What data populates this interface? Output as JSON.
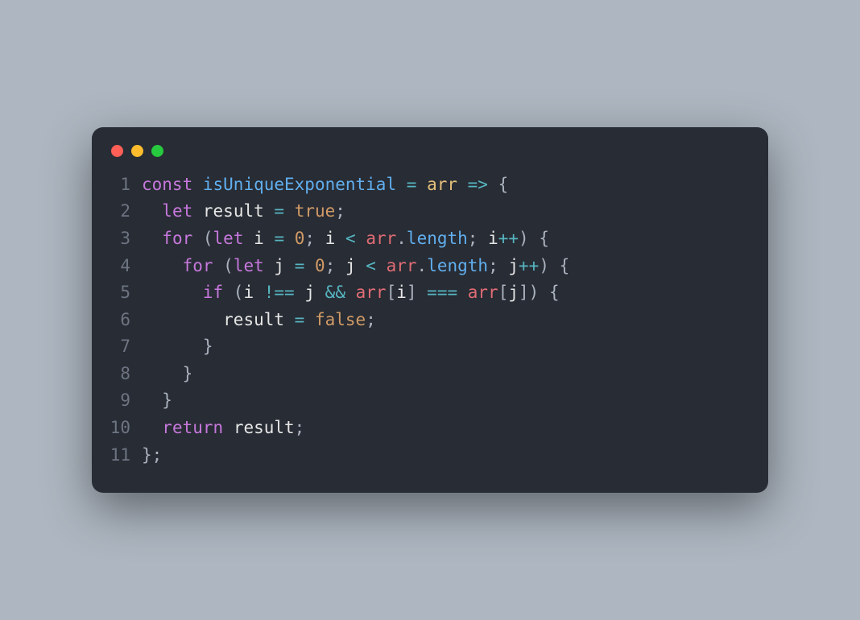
{
  "window": {
    "buttons": [
      "close",
      "minimize",
      "zoom"
    ]
  },
  "code": {
    "lines": [
      {
        "n": "1",
        "tokens": [
          [
            "c-key",
            "const"
          ],
          [
            "c-def",
            " "
          ],
          [
            "c-fn",
            "isUniqueExponential"
          ],
          [
            "c-def",
            " "
          ],
          [
            "c-op",
            "="
          ],
          [
            "c-def",
            " "
          ],
          [
            "c-var2",
            "arr"
          ],
          [
            "c-def",
            " "
          ],
          [
            "c-op",
            "=>"
          ],
          [
            "c-def",
            " {"
          ]
        ]
      },
      {
        "n": "2",
        "tokens": [
          [
            "c-def",
            "  "
          ],
          [
            "c-key",
            "let"
          ],
          [
            "c-def",
            " "
          ],
          [
            "c-white",
            "result"
          ],
          [
            "c-def",
            " "
          ],
          [
            "c-op",
            "="
          ],
          [
            "c-def",
            " "
          ],
          [
            "c-bool",
            "true"
          ],
          [
            "c-def",
            ";"
          ]
        ]
      },
      {
        "n": "3",
        "tokens": [
          [
            "c-def",
            "  "
          ],
          [
            "c-key",
            "for"
          ],
          [
            "c-def",
            " ("
          ],
          [
            "c-key",
            "let"
          ],
          [
            "c-def",
            " "
          ],
          [
            "c-white",
            "i"
          ],
          [
            "c-def",
            " "
          ],
          [
            "c-op",
            "="
          ],
          [
            "c-def",
            " "
          ],
          [
            "c-num",
            "0"
          ],
          [
            "c-def",
            "; "
          ],
          [
            "c-white",
            "i"
          ],
          [
            "c-def",
            " "
          ],
          [
            "c-op",
            "<"
          ],
          [
            "c-def",
            " "
          ],
          [
            "c-var",
            "arr"
          ],
          [
            "c-def",
            "."
          ],
          [
            "c-fn",
            "length"
          ],
          [
            "c-def",
            "; "
          ],
          [
            "c-white",
            "i"
          ],
          [
            "c-op",
            "++"
          ],
          [
            "c-def",
            ") {"
          ]
        ]
      },
      {
        "n": "4",
        "tokens": [
          [
            "c-def",
            "    "
          ],
          [
            "c-key",
            "for"
          ],
          [
            "c-def",
            " ("
          ],
          [
            "c-key",
            "let"
          ],
          [
            "c-def",
            " "
          ],
          [
            "c-white",
            "j"
          ],
          [
            "c-def",
            " "
          ],
          [
            "c-op",
            "="
          ],
          [
            "c-def",
            " "
          ],
          [
            "c-num",
            "0"
          ],
          [
            "c-def",
            "; "
          ],
          [
            "c-white",
            "j"
          ],
          [
            "c-def",
            " "
          ],
          [
            "c-op",
            "<"
          ],
          [
            "c-def",
            " "
          ],
          [
            "c-var",
            "arr"
          ],
          [
            "c-def",
            "."
          ],
          [
            "c-fn",
            "length"
          ],
          [
            "c-def",
            "; "
          ],
          [
            "c-white",
            "j"
          ],
          [
            "c-op",
            "++"
          ],
          [
            "c-def",
            ") {"
          ]
        ]
      },
      {
        "n": "5",
        "tokens": [
          [
            "c-def",
            "      "
          ],
          [
            "c-key",
            "if"
          ],
          [
            "c-def",
            " ("
          ],
          [
            "c-white",
            "i"
          ],
          [
            "c-def",
            " "
          ],
          [
            "c-op",
            "!=="
          ],
          [
            "c-def",
            " "
          ],
          [
            "c-white",
            "j"
          ],
          [
            "c-def",
            " "
          ],
          [
            "c-op",
            "&&"
          ],
          [
            "c-def",
            " "
          ],
          [
            "c-var",
            "arr"
          ],
          [
            "c-def",
            "["
          ],
          [
            "c-white",
            "i"
          ],
          [
            "c-def",
            "] "
          ],
          [
            "c-op",
            "==="
          ],
          [
            "c-def",
            " "
          ],
          [
            "c-var",
            "arr"
          ],
          [
            "c-def",
            "["
          ],
          [
            "c-white",
            "j"
          ],
          [
            "c-def",
            "]) {"
          ]
        ]
      },
      {
        "n": "6",
        "tokens": [
          [
            "c-def",
            "        "
          ],
          [
            "c-white",
            "result"
          ],
          [
            "c-def",
            " "
          ],
          [
            "c-op",
            "="
          ],
          [
            "c-def",
            " "
          ],
          [
            "c-bool",
            "false"
          ],
          [
            "c-def",
            ";"
          ]
        ]
      },
      {
        "n": "7",
        "tokens": [
          [
            "c-def",
            "      }"
          ]
        ]
      },
      {
        "n": "8",
        "tokens": [
          [
            "c-def",
            "    }"
          ]
        ]
      },
      {
        "n": "9",
        "tokens": [
          [
            "c-def",
            "  }"
          ]
        ]
      },
      {
        "n": "10",
        "tokens": [
          [
            "c-def",
            "  "
          ],
          [
            "c-key",
            "return"
          ],
          [
            "c-def",
            " "
          ],
          [
            "c-white",
            "result"
          ],
          [
            "c-def",
            ";"
          ]
        ]
      },
      {
        "n": "11",
        "tokens": [
          [
            "c-def",
            "};"
          ]
        ]
      }
    ]
  }
}
